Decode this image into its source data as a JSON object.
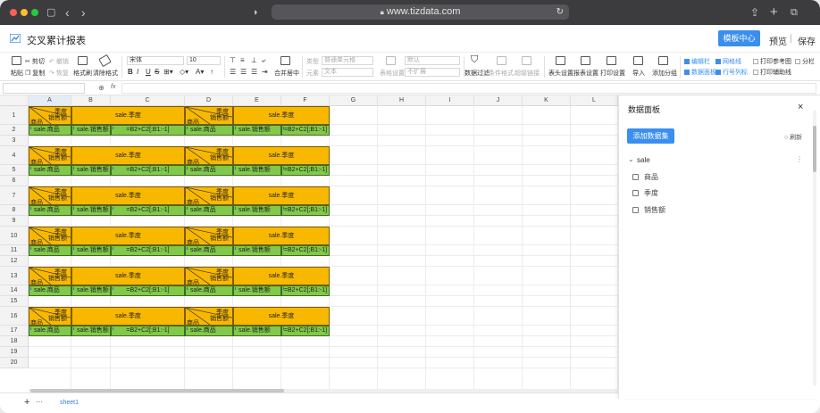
{
  "browser": {
    "url": "www.tizdata.com"
  },
  "app": {
    "title": "交叉累计报表",
    "btn_center": "模板中心",
    "preview": "预览",
    "sep": "|",
    "save": "保存"
  },
  "toolbar": {
    "paste": "粘贴",
    "cut": "剪切",
    "copy": "复制",
    "undo": "撤销",
    "redo": "恢复",
    "format_painter": "格式刷",
    "clear_format": "清除格式",
    "font": "宋体",
    "size": "10",
    "bold": "B",
    "italic": "I",
    "underline": "U",
    "strike": "S",
    "merge_center": "合并居中",
    "cell_type_label": "类型",
    "cell_type": "普通单元格",
    "elem_label": "元素",
    "elem": "文本",
    "table_set": "表格设置",
    "default": "默认",
    "no_expand": "不扩展",
    "filter": "数据过滤",
    "cond_format": "条件格式",
    "hyperlink": "超级链接",
    "header_set": "表头设置",
    "report_set": "报表设置",
    "print_set": "打印设置",
    "import": "导入",
    "add_group": "添加分组",
    "edit_bar": "编辑栏",
    "gridline": "网格线",
    "print_ref": "打印参考图",
    "split": "分栏",
    "data_panel": "数据面板",
    "rowcol_label": "行号列标",
    "print_helper": "打印辅助线"
  },
  "formula_bar": {
    "fx": "fx"
  },
  "grid": {
    "columns": [
      "A",
      "B",
      "C",
      "D",
      "E",
      "F",
      "G",
      "H",
      "I",
      "J",
      "K",
      "L"
    ],
    "rows": [
      "1",
      "2",
      "3",
      "4",
      "5",
      "6",
      "7",
      "8",
      "9",
      "10",
      "11",
      "12",
      "13",
      "14",
      "15",
      "16",
      "17",
      "18",
      "19",
      "20"
    ],
    "block": {
      "season": "季度",
      "sales_hdr": "销售额",
      "product_hdr": "商品",
      "merged": "sale.季度",
      "r2": [
        "sale.商品",
        "sale.销售额",
        "=B2+C2[;B1:-1]"
      ]
    }
  },
  "sheet": {
    "plus": "+",
    "more": "···",
    "tab": "sheet1"
  },
  "panel": {
    "title": "数据面板",
    "close": "×",
    "add_dataset": "添加数据集",
    "refresh": "刷新",
    "dataset": "sale",
    "fields": [
      "商品",
      "季度",
      "销售额"
    ]
  },
  "colors": {
    "header_fill": "#f9b800",
    "data_fill": "#82c94a",
    "accent": "#3a8fee"
  }
}
